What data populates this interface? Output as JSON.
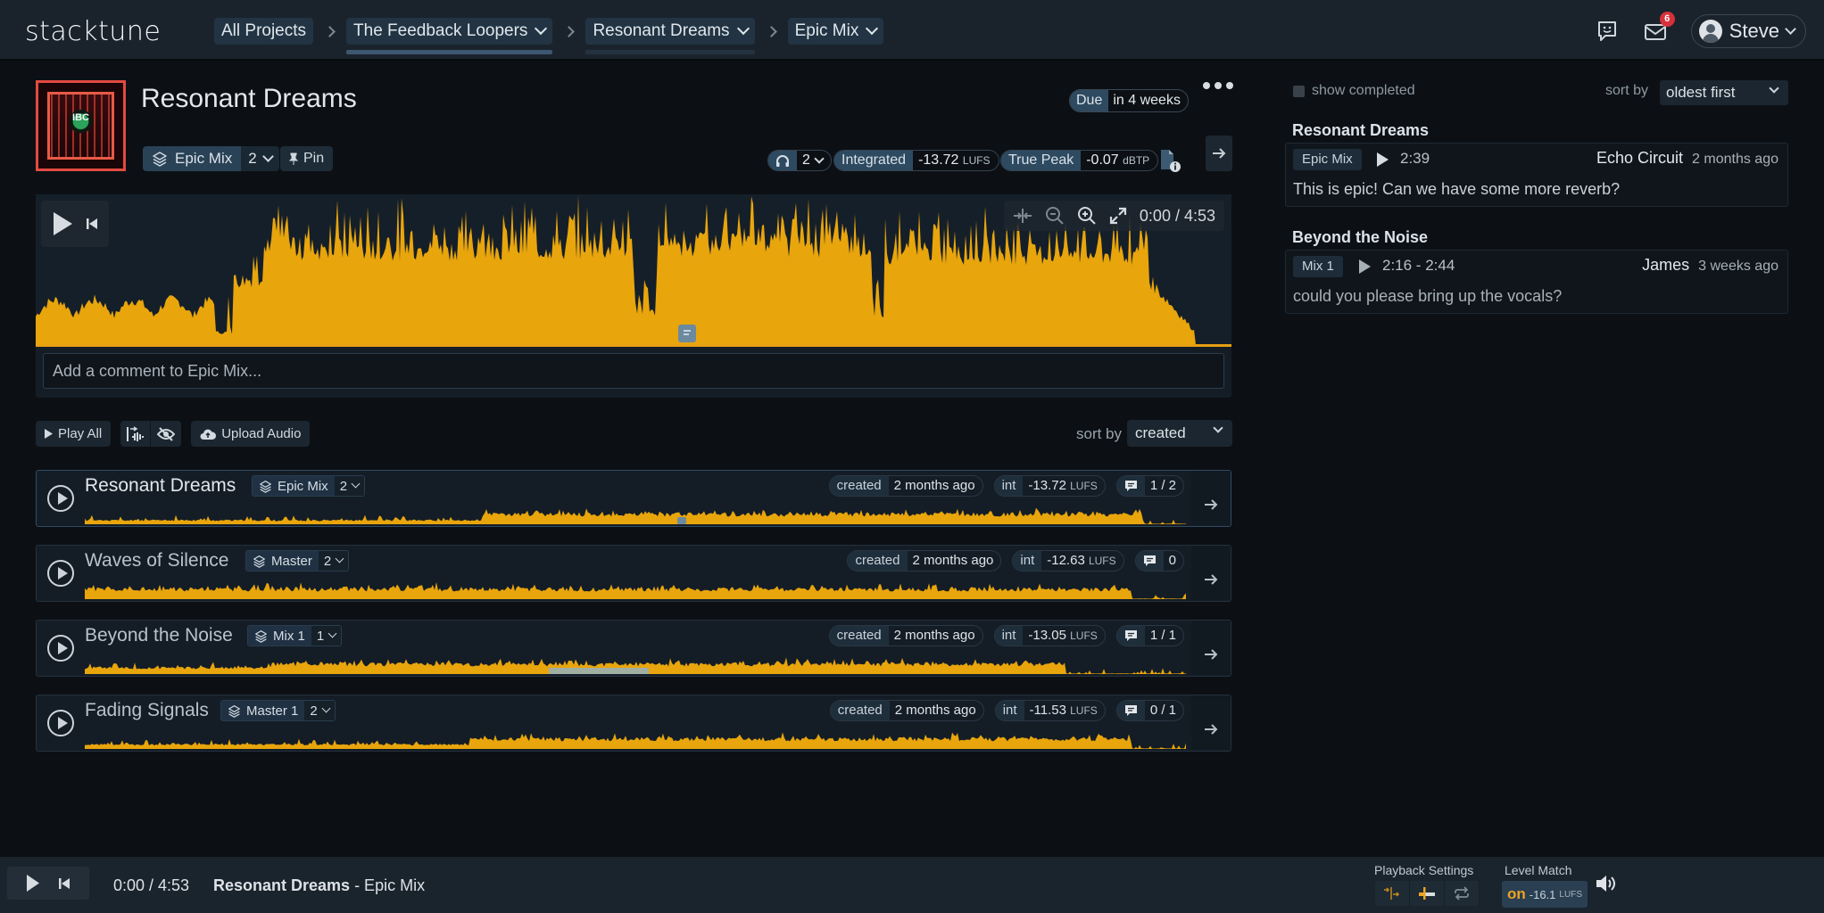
{
  "app": {
    "logo": "stacktune"
  },
  "breadcrumb": {
    "items": [
      {
        "label": "All Projects",
        "dropdown": false
      },
      {
        "label": "The Feedback Loopers",
        "dropdown": true
      },
      {
        "label": "Resonant Dreams",
        "dropdown": true
      },
      {
        "label": "Epic Mix",
        "dropdown": true
      }
    ]
  },
  "header": {
    "notifications_count": "6",
    "user_name": "Steve"
  },
  "track": {
    "title": "Resonant Dreams",
    "artwork_text": "IBC",
    "version_name": "Epic Mix",
    "version_count": "2",
    "pin_label": "Pin",
    "due_label": "Due",
    "due_value": "in 4 weeks",
    "listeners_count": "2",
    "integrated_label": "Integrated",
    "integrated_value": "-13.72",
    "integrated_unit": "LUFS",
    "true_peak_label": "True Peak",
    "true_peak_value": "-0.07",
    "true_peak_unit": "dBTP"
  },
  "waveform": {
    "time": "0:00 / 4:53",
    "comment_placeholder": "Add a comment to Epic Mix...",
    "color": "#e8a50c"
  },
  "toolbar": {
    "play_all": "Play All",
    "upload_audio": "Upload Audio",
    "sort_label": "sort by",
    "sort_value": "created"
  },
  "tracks": [
    {
      "name": "Resonant Dreams",
      "version": "Epic Mix",
      "count": "2",
      "created_label": "created",
      "created": "2 months ago",
      "int_label": "int",
      "int": "-13.72",
      "unit": "LUFS",
      "comments": "1 / 2",
      "active": true
    },
    {
      "name": "Waves of Silence",
      "version": "Master",
      "count": "2",
      "created_label": "created",
      "created": "2 months ago",
      "int_label": "int",
      "int": "-12.63",
      "unit": "LUFS",
      "comments": "0",
      "active": false
    },
    {
      "name": "Beyond the Noise",
      "version": "Mix 1",
      "count": "1",
      "created_label": "created",
      "created": "2 months ago",
      "int_label": "int",
      "int": "-13.05",
      "unit": "LUFS",
      "comments": "1 / 1",
      "active": false
    },
    {
      "name": "Fading Signals",
      "version": "Master 1",
      "count": "2",
      "created_label": "created",
      "created": "2 months ago",
      "int_label": "int",
      "int": "-11.53",
      "unit": "LUFS",
      "comments": "0 / 1",
      "active": false
    }
  ],
  "comments_panel": {
    "show_completed": "show completed",
    "sort_label": "sort by",
    "sort_value": "oldest first",
    "groups": [
      {
        "track": "Resonant Dreams",
        "tag": "Epic Mix",
        "time": "2:39",
        "author": "Echo Circuit",
        "ago": "2 months ago",
        "message": "This is epic! Can we have some more reverb?"
      },
      {
        "track": "Beyond the Noise",
        "tag": "Mix 1",
        "time": "2:16 - 2:44",
        "author": "James",
        "ago": "3 weeks ago",
        "message": "could you please bring up the vocals?"
      }
    ]
  },
  "player": {
    "time": "0:00 / 4:53",
    "track": "Resonant Dreams",
    "version": " - Epic Mix",
    "playback_settings_label": "Playback Settings",
    "level_match_label": "Level Match",
    "level_match_state": "on",
    "level_match_value": "-16.1",
    "level_match_unit": "LUFS"
  }
}
